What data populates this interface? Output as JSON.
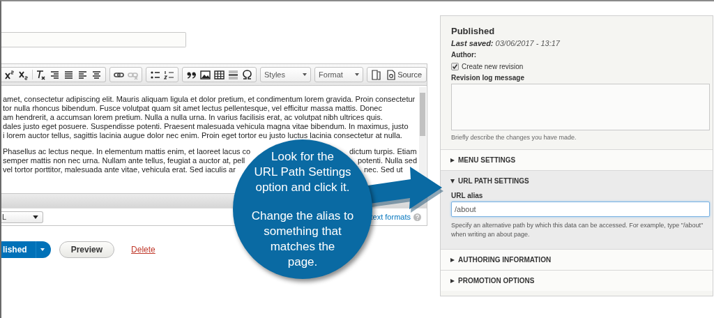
{
  "toolbar": {
    "styles_label": "Styles",
    "format_label": "Format",
    "source_label": "Source"
  },
  "editor": {
    "paragraphs": [
      [
        [
          "amet, consectetur adipiscing elit. Mauris aliquam ligula et dolor pretium, et condimentum lorem gravida. Proin consectetur"
        ],
        [
          "tor nulla rhoncus bibendum. Fusce volutpat quam sit amet lectus pellentesque, vel efficitur massa mattis. Donec"
        ],
        [
          "am hendrerit, a accumsan lorem pretium. Nulla a nulla urna. In varius facilisis erat, ac volutpat nibh ultrices quis."
        ],
        [
          "dales justo eget posuere. Suspendisse potenti. Praesent malesuada vehicula magna vitae bibendum. In maximus, justo"
        ],
        [
          "i lorem auctor tellus, sagittis lacinia augue dolor nec enim. Proin eget tortor eu justo luctus lacinia consectetur at nulla."
        ]
      ],
      [
        [
          "Phasellus ac lectus neque. In elementum mattis enim, et laoreet lacus co",
          "dictum turpis. Etiam"
        ],
        [
          "semper mattis non nec urna. Nullam ante tellus, feugiat a auctor at, pell",
          "potenti. Nulla sed"
        ],
        [
          "vel tortor porttitor, malesuada ante vitae, vehicula erat. Sed iaculis ar",
          "nec. Sed ut"
        ]
      ]
    ]
  },
  "text_format": {
    "select_value": "L",
    "link": "text formats"
  },
  "actions": [
    {
      "kind": "split",
      "label": "lished"
    },
    {
      "kind": "plain",
      "label": "Preview"
    },
    {
      "kind": "link",
      "label": "Delete"
    }
  ],
  "sidebar": {
    "status": "Published",
    "last_saved": "**Last saved:** 03/06/2017 - 13:17",
    "author_label": "Author:",
    "revision": {
      "label": "Create new revision",
      "checked": true
    },
    "log_label": "Revision log message",
    "log_help": "Briefly describe the changes you have made.",
    "sections": [
      {
        "title": "MENU SETTINGS",
        "expanded": false
      },
      {
        "title": "URL PATH SETTINGS",
        "expanded": true,
        "field_label": "URL alias",
        "value": "/about",
        "help": "Specify an alternative path by which this data can be accessed. For example, type \"/about\" when writing an about page."
      },
      {
        "title": "AUTHORING INFORMATION",
        "expanded": false
      },
      {
        "title": "PROMOTION OPTIONS",
        "expanded": false
      }
    ]
  },
  "callout": {
    "paragraphs": [
      [
        "Look for the",
        "URL Path Settings",
        "option and click it."
      ],
      [
        "Change the alias to",
        "something that",
        "matches the",
        "page."
      ]
    ]
  }
}
